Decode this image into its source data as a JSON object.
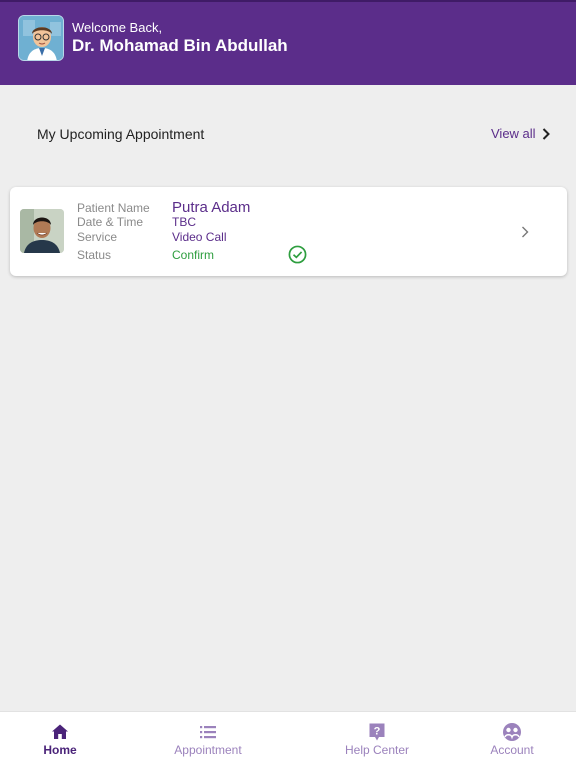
{
  "header": {
    "welcome_text": "Welcome Back,",
    "doctor_name": "Dr. Mohamad Bin Abdullah",
    "background_color": "#5b2d8a",
    "avatar_icon": "doctor-avatar-icon"
  },
  "appointments": {
    "section_title": "My Upcoming Appointment",
    "view_all_label": "View all",
    "card": {
      "patient_name_label": "Patient Name",
      "patient_name": "Putra Adam",
      "datetime_label": "Date & Time",
      "datetime_value": "TBC",
      "service_label": "Service",
      "service_value": "Video Call",
      "status_label": "Status",
      "status_value": "Confirm",
      "status_color": "#2e9e3f",
      "status_icon": "check-circle-icon"
    }
  },
  "bottom_nav": {
    "items": [
      {
        "label": "Home",
        "icon": "home-icon",
        "active": true
      },
      {
        "label": "Appointment",
        "icon": "list-icon",
        "active": false
      },
      {
        "label": "Help Center",
        "icon": "help-icon",
        "active": false
      },
      {
        "label": "Account",
        "icon": "account-icon",
        "active": false
      }
    ],
    "active_color": "#4a2379",
    "inactive_color": "#9b82bc"
  }
}
